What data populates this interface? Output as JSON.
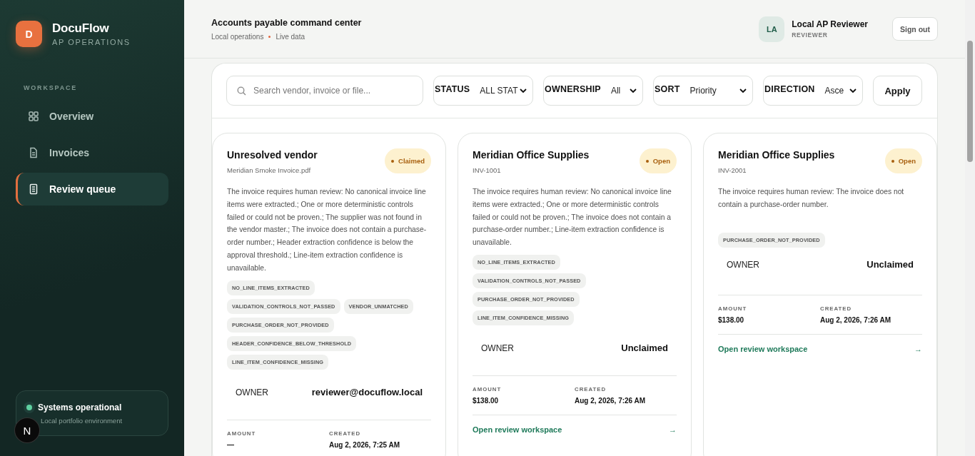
{
  "brand": {
    "initial": "D",
    "name": "DocuFlow",
    "subtitle": "AP OPERATIONS"
  },
  "sidebar": {
    "section": "WORKSPACE",
    "items": [
      {
        "label": "Overview",
        "kind": "grid",
        "selected": false
      },
      {
        "label": "Invoices",
        "kind": "file",
        "selected": false
      },
      {
        "label": "Review queue",
        "kind": "list",
        "selected": true
      }
    ]
  },
  "system_status": {
    "title": "Systems operational",
    "subtitle": "Local portfolio environment"
  },
  "dev_badge": "N",
  "header": {
    "title": "Accounts payable command center",
    "meta": [
      "Local operations",
      "Live data"
    ]
  },
  "user": {
    "initials": "LA",
    "name": "Local AP Reviewer",
    "role": "REVIEWER",
    "sign_out": "Sign out"
  },
  "filters": {
    "search": {
      "placeholder": "Search vendor, invoice or file..."
    },
    "selects": [
      {
        "label": "STATUS",
        "value": "ALL STAT"
      },
      {
        "label": "OWNERSHIP",
        "value": "All"
      },
      {
        "label": "SORT",
        "value": "Priority"
      },
      {
        "label": "DIRECTION",
        "value": "Asce"
      }
    ],
    "apply": "Apply"
  },
  "cards": [
    {
      "title": "Unresolved vendor",
      "subtitle": "Meridian Smoke Invoice.pdf",
      "badge": "Claimed",
      "description": "The invoice requires human review: No canonical invoice line items were extracted.; One or more deterministic controls failed or could not be proven.; The supplier was not found in the vendor master.; The invoice does not contain a purchase-order number.; Header extraction confidence is below the approval threshold.; Line-item extraction confidence is unavailable.",
      "tags": [
        "NO_LINE_ITEMS_EXTRACTED",
        "VALIDATION_CONTROLS_NOT_PASSED",
        "VENDOR_UNMATCHED",
        "PURCHASE_ORDER_NOT_PROVIDED",
        "HEADER_CONFIDENCE_BELOW_THRESHOLD",
        "LINE_ITEM_CONFIDENCE_MISSING"
      ],
      "owner_label": "OWNER",
      "owner": "reviewer@docuflow.local",
      "amount_label": "AMOUNT",
      "amount": "—",
      "created_label": "CREATED",
      "created": "Aug 2, 2026, 7:25 AM"
    },
    {
      "title": "Meridian Office Supplies",
      "subtitle": "INV-1001",
      "badge": "Open",
      "description": "The invoice requires human review: No canonical invoice line items were extracted.; One or more deterministic controls failed or could not be proven.; The invoice does not contain a purchase-order number.; Line-item extraction confidence is unavailable.",
      "tags": [
        "NO_LINE_ITEMS_EXTRACTED",
        "VALIDATION_CONTROLS_NOT_PASSED",
        "PURCHASE_ORDER_NOT_PROVIDED",
        "LINE_ITEM_CONFIDENCE_MISSING"
      ],
      "owner_label": "OWNER",
      "owner": "Unclaimed",
      "amount_label": "AMOUNT",
      "amount": "$138.00",
      "created_label": "CREATED",
      "created": "Aug 2, 2026, 7:26 AM",
      "link": "Open review workspace",
      "link_arrow": "→"
    },
    {
      "title": "Meridian Office Supplies",
      "subtitle": "INV-2001",
      "badge": "Open",
      "description": "The invoice requires human review: The invoice does not contain a purchase-order number.",
      "tags": [
        "PURCHASE_ORDER_NOT_PROVIDED"
      ],
      "owner_label": "OWNER",
      "owner": "Unclaimed",
      "amount_label": "AMOUNT",
      "amount": "$138.00",
      "created_label": "CREATED",
      "created": "Aug 2, 2026, 7:26 AM",
      "link": "Open review workspace",
      "link_arrow": "→"
    }
  ]
}
